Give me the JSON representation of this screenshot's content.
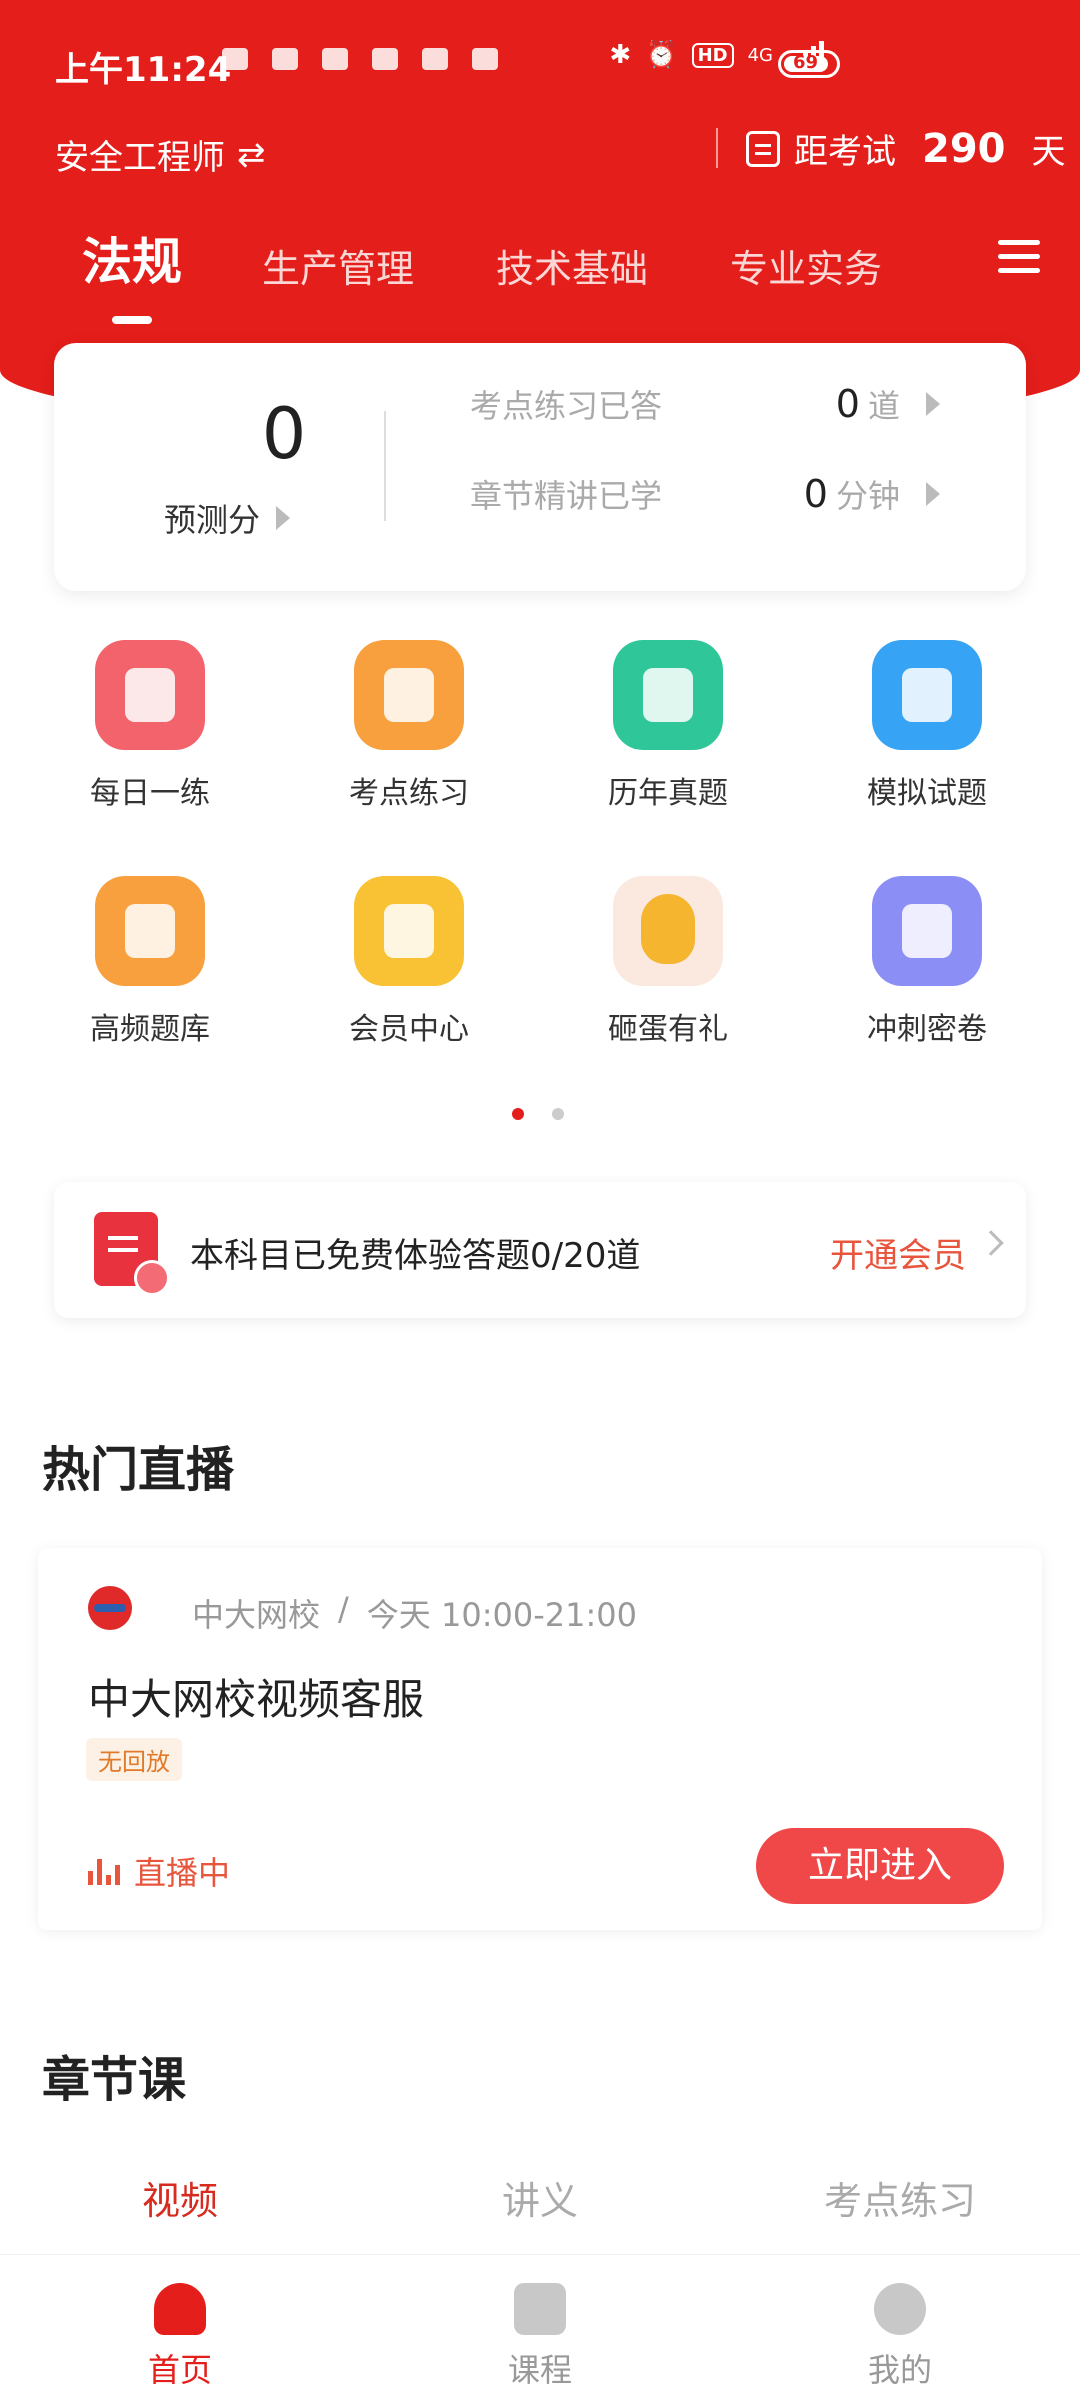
{
  "status_bar": {
    "time": "上午11:24",
    "battery": "69",
    "network": "4G"
  },
  "header": {
    "subject": "安全工程师",
    "exam_prefix": "距考试",
    "exam_days": "290",
    "exam_suffix": "天"
  },
  "tabs": [
    {
      "label": "法规",
      "active": true
    },
    {
      "label": "生产管理",
      "active": false
    },
    {
      "label": "技术基础",
      "active": false
    },
    {
      "label": "专业实务",
      "active": false
    }
  ],
  "score_card": {
    "score": "0",
    "score_label": "预测分",
    "stats": [
      {
        "label": "考点练习已答",
        "value": "0",
        "unit": "道"
      },
      {
        "label": "章节精讲已学",
        "value": "0",
        "unit": "分钟"
      }
    ]
  },
  "grid": [
    {
      "label": "每日一练",
      "icon": "calendar-check-icon",
      "color": "#f2636c"
    },
    {
      "label": "考点练习",
      "icon": "lightning-icon",
      "color": "#f7a03d"
    },
    {
      "label": "历年真题",
      "icon": "document-icon",
      "color": "#2fc79a"
    },
    {
      "label": "模拟试题",
      "icon": "chart-screen-icon",
      "color": "#36a3f5"
    },
    {
      "label": "高频题库",
      "icon": "pulse-icon",
      "color": "#f7a03d"
    },
    {
      "label": "会员中心",
      "icon": "crown-icon",
      "color": "#f8c234"
    },
    {
      "label": "砸蛋有礼",
      "icon": "golden-egg-icon",
      "color": "#f5b52e"
    },
    {
      "label": "冲刺密卷",
      "icon": "book-icon",
      "color": "#8b8ef5"
    }
  ],
  "pager": {
    "current": 1,
    "total": 2
  },
  "free_banner": {
    "text": "本科目已免费体验答题0/20道",
    "action": "开通会员"
  },
  "live_section": {
    "title": "热门直播",
    "org": "中大网校",
    "sep": "/",
    "time": "今天  10:00-21:00",
    "name": "中大网校视频客服",
    "tag": "无回放",
    "state": "直播中",
    "enter": "立即进入"
  },
  "chapter_section": {
    "title": "章节课",
    "tabs": [
      {
        "label": "视频",
        "active": true
      },
      {
        "label": "讲义",
        "active": false
      },
      {
        "label": "考点练习",
        "active": false
      }
    ]
  },
  "bottom_nav": [
    {
      "label": "首页",
      "active": true
    },
    {
      "label": "课程",
      "active": false
    },
    {
      "label": "我的",
      "active": false
    }
  ],
  "colors": {
    "brand": "#e41e1a",
    "accent": "#f04848"
  }
}
